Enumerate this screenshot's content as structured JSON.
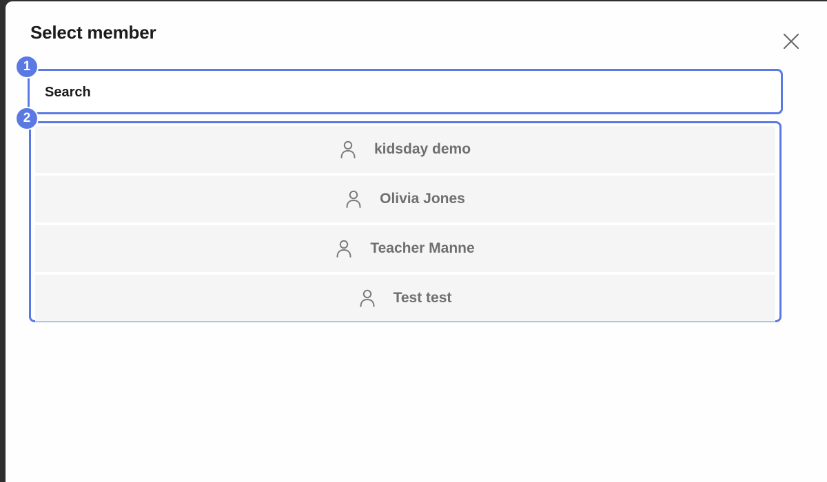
{
  "modal": {
    "title": "Select member",
    "close_icon": "close-icon"
  },
  "search": {
    "placeholder": "Search",
    "value": ""
  },
  "annotations": [
    {
      "label": "1"
    },
    {
      "label": "2"
    }
  ],
  "members": [
    {
      "name": "kidsday demo",
      "icon": "user-icon"
    },
    {
      "name": "Olivia Jones",
      "icon": "user-icon"
    },
    {
      "name": "Teacher Manne",
      "icon": "user-icon"
    },
    {
      "name": "Test test",
      "icon": "user-icon"
    }
  ],
  "colors": {
    "accent": "#5b79e3",
    "item_bg": "#f5f5f5",
    "item_text": "#6f6f6f",
    "title_text": "#1b1b1b"
  }
}
